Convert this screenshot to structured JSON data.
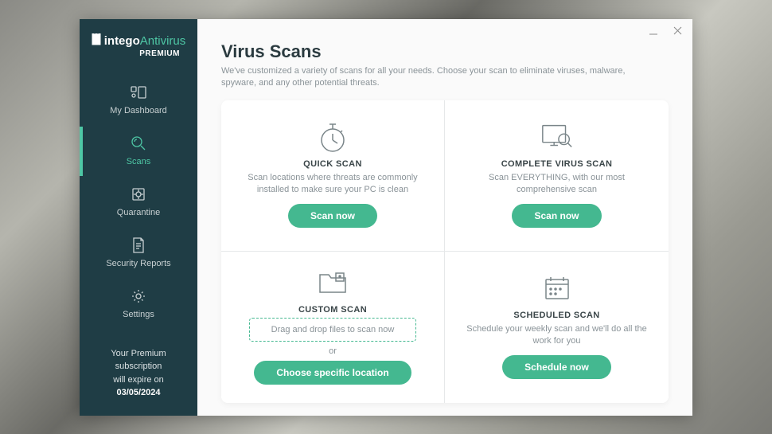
{
  "logo": {
    "brand": "intego",
    "product": "Antivirus",
    "tier": "PREMIUM"
  },
  "sidebar": {
    "items": [
      {
        "label": "My Dashboard",
        "icon": "dashboard-icon"
      },
      {
        "label": "Scans",
        "icon": "scan-icon"
      },
      {
        "label": "Quarantine",
        "icon": "quarantine-icon"
      },
      {
        "label": "Security Reports",
        "icon": "reports-icon"
      },
      {
        "label": "Settings",
        "icon": "settings-icon"
      }
    ],
    "activeIndex": 1
  },
  "subscription": {
    "line1": "Your Premium subscription",
    "line2": "will expire on",
    "date": "03/05/2024"
  },
  "page": {
    "title": "Virus Scans",
    "subtitle": "We've customized a variety of scans for all your needs. Choose your scan to eliminate viruses, malware, spyware, and any other potential threats."
  },
  "tiles": {
    "quick": {
      "title": "QUICK SCAN",
      "desc": "Scan locations where threats are commonly installed to make sure your PC is clean",
      "button": "Scan now"
    },
    "complete": {
      "title": "COMPLETE VIRUS SCAN",
      "desc": "Scan EVERYTHING, with our most comprehensive scan",
      "button": "Scan now"
    },
    "custom": {
      "title": "CUSTOM SCAN",
      "dropzone": "Drag and drop files to scan now",
      "or": "or",
      "button": "Choose specific location"
    },
    "scheduled": {
      "title": "SCHEDULED SCAN",
      "desc": "Schedule your weekly scan and we'll do all the work for you",
      "button": "Schedule now"
    }
  }
}
